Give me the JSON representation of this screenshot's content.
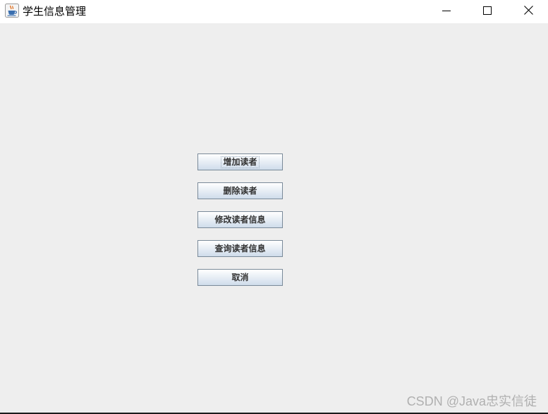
{
  "window": {
    "title": "学生信息管理",
    "app_icon": "java-coffee-cup-icon",
    "controls": {
      "minimize_icon": "minimize-icon",
      "maximize_icon": "maximize-icon",
      "close_icon": "close-icon"
    }
  },
  "menu": {
    "buttons": [
      {
        "label": "增加读者"
      },
      {
        "label": "删除读者"
      },
      {
        "label": "修改读者信息"
      },
      {
        "label": "查询读者信息"
      },
      {
        "label": "取消"
      }
    ]
  },
  "watermark": {
    "text": "CSDN @Java忠实信徒"
  },
  "colors": {
    "background": "#eeeeee",
    "titlebar": "#ffffff",
    "button_border": "#7a8a99",
    "button_text": "#333333"
  }
}
